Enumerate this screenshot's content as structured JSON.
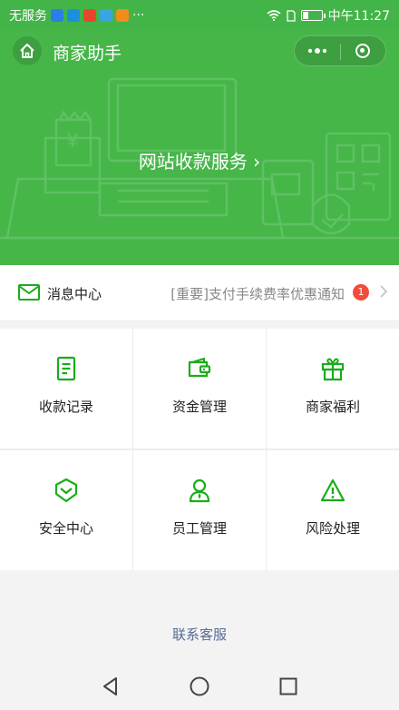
{
  "status_bar": {
    "carrier": "无服务",
    "time": "中午11:27",
    "more": "···",
    "battery_level": 0.3
  },
  "header": {
    "title": "商家助手",
    "more_icon": "ellipsis-icon",
    "close_icon": "circle-close-icon"
  },
  "banner": {
    "cta": "网站收款服务 ›"
  },
  "messages": {
    "title": "消息中心",
    "preview": "[重要]支付手续费率优惠通知",
    "unread": "1"
  },
  "features": [
    {
      "label": "收款记录",
      "icon": "receipt-icon"
    },
    {
      "label": "资金管理",
      "icon": "wallet-icon"
    },
    {
      "label": "商家福利",
      "icon": "gift-icon"
    },
    {
      "label": "安全中心",
      "icon": "shield-icon"
    },
    {
      "label": "员工管理",
      "icon": "staff-icon"
    },
    {
      "label": "风险处理",
      "icon": "warning-icon"
    }
  ],
  "footer": {
    "contact": "联系客服"
  },
  "colors": {
    "brand_green": "#46b649",
    "accent_green": "#1aad19",
    "badge_red": "#f24c3d",
    "link_blue": "#576b95"
  }
}
